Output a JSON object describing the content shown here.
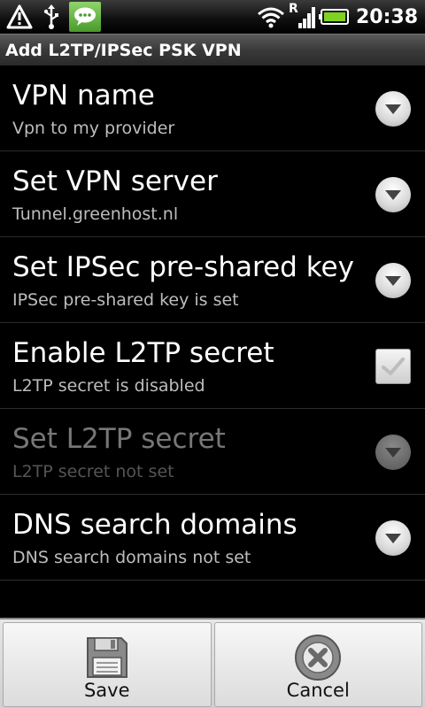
{
  "status_bar": {
    "time": "20:38",
    "roaming_indicator": "R",
    "icons": [
      "warning-icon",
      "usb-icon",
      "chat-notification-icon",
      "wifi-icon",
      "signal-icon",
      "battery-icon"
    ]
  },
  "title_bar": {
    "title": "Add L2TP/IPSec PSK VPN"
  },
  "settings": [
    {
      "title": "VPN name",
      "summary": "Vpn to my provider",
      "control": "dropdown",
      "enabled": true
    },
    {
      "title": "Set VPN server",
      "summary": "Tunnel.greenhost.nl",
      "control": "dropdown",
      "enabled": true
    },
    {
      "title": "Set IPSec pre-shared key",
      "summary": "IPSec pre-shared key is set",
      "control": "dropdown",
      "enabled": true
    },
    {
      "title": "Enable L2TP secret",
      "summary": "L2TP secret is disabled",
      "control": "checkbox",
      "enabled": true
    },
    {
      "title": "Set L2TP secret",
      "summary": "L2TP secret not set",
      "control": "dropdown",
      "enabled": false
    },
    {
      "title": "DNS search domains",
      "summary": "DNS search domains not set",
      "control": "dropdown",
      "enabled": true
    }
  ],
  "buttons": {
    "save_label": "Save",
    "cancel_label": "Cancel"
  }
}
